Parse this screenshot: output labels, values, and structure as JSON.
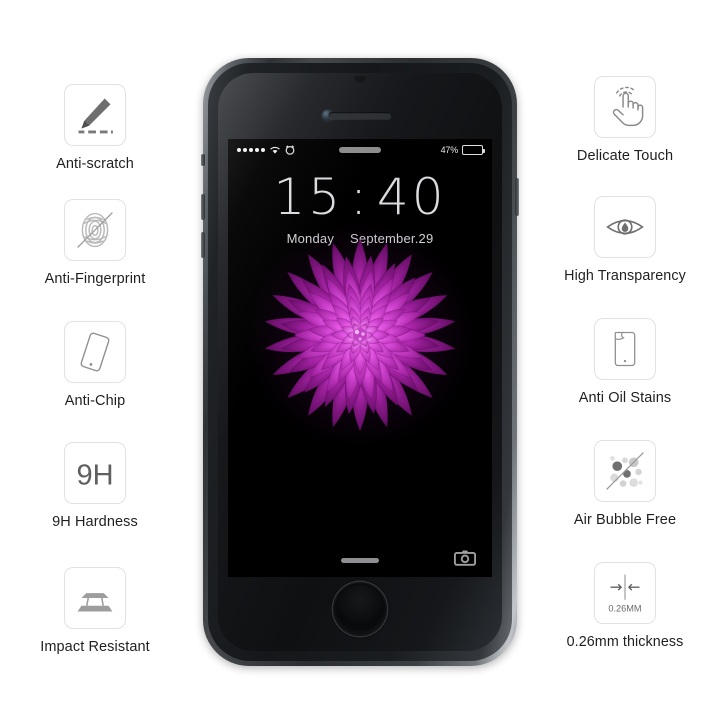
{
  "page": {
    "background": "#ffffff",
    "accent_purple": "#d13ad1"
  },
  "features_left": [
    {
      "icon": "pen-scratch-icon",
      "label": "Anti-scratch"
    },
    {
      "icon": "fingerprint-icon",
      "label": "Anti-Fingerprint"
    },
    {
      "icon": "tilted-phone-icon",
      "label": "Anti-Chip"
    },
    {
      "icon": "hardness-9h-icon",
      "label": "9H Hardness",
      "badge": "9H"
    },
    {
      "icon": "impact-layers-icon",
      "label": "Impact Resistant"
    }
  ],
  "features_right": [
    {
      "icon": "touch-hand-icon",
      "label": "Delicate Touch"
    },
    {
      "icon": "eye-icon",
      "label": "High Transparency"
    },
    {
      "icon": "oil-drop-phone-icon",
      "label": "Anti Oil Stains"
    },
    {
      "icon": "bubbles-icon",
      "label": "Air Bubble Free"
    },
    {
      "icon": "thickness-icon",
      "label": "0.26mm thickness",
      "badge": "0.26MM"
    }
  ],
  "phone": {
    "device_name": "smartphone-mockup",
    "screen": {
      "statusbar": {
        "signal_dots": 5,
        "wifi_icon": "wifi-icon",
        "alarm_icon": "alarm-clock-icon",
        "carrier_pill": "carrier-name-pill",
        "battery_percent": "47%",
        "battery_level": 47
      },
      "lockscreen": {
        "time_hours": "15",
        "time_separator": ":",
        "time_minutes": "40",
        "day": "Monday",
        "date": "September.29",
        "wallpaper": "purple-dahlia-flower",
        "slide_handle": "slide-to-unlock-handle",
        "camera_shortcut": "camera-icon"
      }
    },
    "hardware": {
      "earpiece": "earpiece-speaker",
      "front_camera": "front-camera",
      "top_sensor": "proximity-sensor-notch",
      "home_button": "home-button",
      "mute_switch": "mute-switch",
      "volume_up": "volume-up-button",
      "volume_down": "volume-down-button",
      "power_button": "power-button"
    }
  }
}
